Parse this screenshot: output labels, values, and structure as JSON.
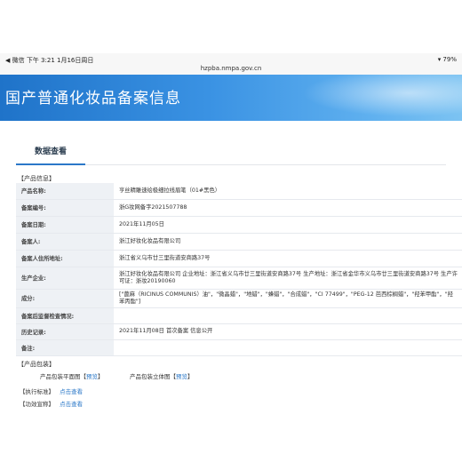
{
  "status_bar": {
    "left": "◀ 微信  下午 3:21  1月16日周日",
    "right": "▾ 79%"
  },
  "url": "hzpba.nmpa.gov.cn",
  "banner": {
    "title": "国产普通化妆品备案信息"
  },
  "tab": {
    "label": "数据查看"
  },
  "section": {
    "product_info": "【产品信息】"
  },
  "rows": [
    {
      "label": "产品名称:",
      "value": "亨丝精雕速绘极细拉线眉笔（01#黑色）"
    },
    {
      "label": "备案编号:",
      "value": "浙G妆网备字2021507788"
    },
    {
      "label": "备案日期:",
      "value": "2021年11月05日"
    },
    {
      "label": "备案人:",
      "value": "浙江好妆化妆品有限公司"
    },
    {
      "label": "备案人住所地址:",
      "value": "浙江省义乌市廿三里街道安商路37号"
    },
    {
      "label": "生产企业:",
      "value": "浙江好妆化妆品有限公司 企业地址：浙江省义乌市廿三里街道安商路37号 生产地址：浙江省金华市义乌市廿三里街道安商路37号 生产许可证：浙妆20190060"
    },
    {
      "label": "成分:",
      "value": "[\"蓖麻（RICINUS COMMUNIS）油\"，\"微晶蜡\"，\"地蜡\"，\"蜂蜡\"，\"合成蜡\"，\"CI 77499\"，\"PEG-12 芭西棕榈蜡\"，\"羟苯甲酯\"，\"羟苯丙酯\"]"
    },
    {
      "label": "备案后监督检查情况:",
      "value": ""
    },
    {
      "label": "历史记录:",
      "value": "2021年11月08日 首次备案 信息公开"
    },
    {
      "label": "备注:",
      "value": ""
    }
  ],
  "packaging": {
    "title": "【产品包装】",
    "plan_label": "产品包装平面图",
    "plan_link": "预览",
    "solid_label": "产品包装立体图",
    "solid_link": "预览"
  },
  "standard": {
    "label": "【执行标准】",
    "link": "点击查看"
  },
  "efficacy": {
    "label": "【功效宣称】",
    "link": "点击查看"
  }
}
